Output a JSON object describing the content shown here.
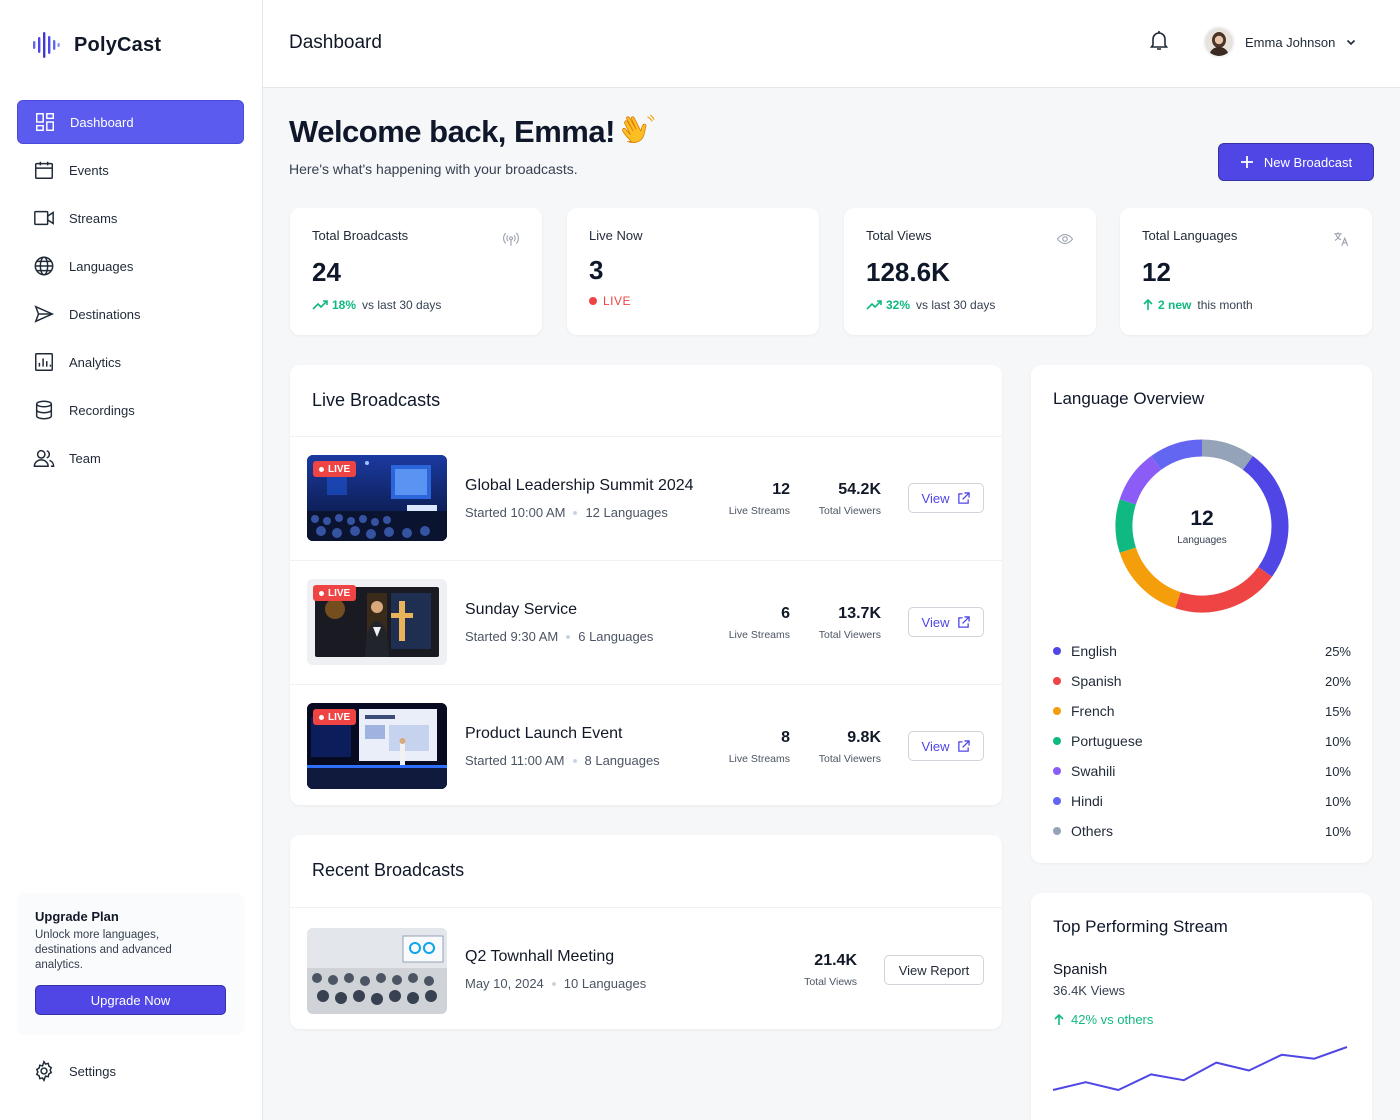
{
  "brand": {
    "name": "PolyCast"
  },
  "sidebar": {
    "items": [
      {
        "label": "Dashboard",
        "icon": "dashboard-icon",
        "active": true
      },
      {
        "label": "Events",
        "icon": "calendar-icon"
      },
      {
        "label": "Streams",
        "icon": "video-icon"
      },
      {
        "label": "Languages",
        "icon": "globe-icon"
      },
      {
        "label": "Destinations",
        "icon": "send-icon"
      },
      {
        "label": "Analytics",
        "icon": "analytics-icon"
      },
      {
        "label": "Recordings",
        "icon": "database-icon"
      },
      {
        "label": "Team",
        "icon": "team-icon"
      }
    ],
    "upgrade": {
      "title": "Upgrade Plan",
      "desc": "Unlock more languages, destinations and advanced analytics.",
      "button": "Upgrade Now"
    },
    "settings": "Settings"
  },
  "header": {
    "title": "Dashboard",
    "user_name": "Emma Johnson"
  },
  "welcome": {
    "title": "Welcome back, Emma!",
    "subtitle": "Here's what's happening with your broadcasts.",
    "new_button": "New Broadcast"
  },
  "stats": [
    {
      "label": "Total Broadcasts",
      "value": "24",
      "delta": "18%",
      "note": "vs last 30 days"
    },
    {
      "label": "Live Now",
      "value": "3",
      "badge": "LIVE"
    },
    {
      "label": "Total Views",
      "value": "128.6K",
      "delta": "32%",
      "note": "vs last 30 days"
    },
    {
      "label": "Total Languages",
      "value": "12",
      "delta": "2 new",
      "note": "this month"
    }
  ],
  "live": {
    "title": "Live Broadcasts",
    "badge": "LIVE",
    "view_label": "View",
    "streams_label": "Live Streams",
    "viewers_label": "Total Viewers",
    "items": [
      {
        "name": "Global Leadership Summit 2024",
        "started": "Started 10:00 AM",
        "languages": "12 Languages",
        "streams": "12",
        "viewers": "54.2K"
      },
      {
        "name": "Sunday Service",
        "started": "Started 9:30 AM",
        "languages": "6 Languages",
        "streams": "6",
        "viewers": "13.7K"
      },
      {
        "name": "Product Launch Event",
        "started": "Started 11:00 AM",
        "languages": "8 Languages",
        "streams": "8",
        "viewers": "9.8K"
      }
    ]
  },
  "recent": {
    "title": "Recent Broadcasts",
    "items": [
      {
        "name": "Q2 Townhall Meeting",
        "date": "May 10, 2024",
        "languages": "10 Languages",
        "views": "21.4K",
        "views_label": "Total Views",
        "button": "View Report"
      }
    ]
  },
  "language_overview": {
    "title": "Language Overview",
    "center_value": "12",
    "center_label": "Languages",
    "items": [
      {
        "name": "English",
        "pct": "25%",
        "value": 25,
        "color": "#4f46e5"
      },
      {
        "name": "Spanish",
        "pct": "20%",
        "value": 20,
        "color": "#ef4444"
      },
      {
        "name": "French",
        "pct": "15%",
        "value": 15,
        "color": "#f59e0b"
      },
      {
        "name": "Portuguese",
        "pct": "10%",
        "value": 10,
        "color": "#10b981"
      },
      {
        "name": "Swahili",
        "pct": "10%",
        "value": 10,
        "color": "#8b5cf6"
      },
      {
        "name": "Hindi",
        "pct": "10%",
        "value": 10,
        "color": "#6366f1"
      },
      {
        "name": "Others",
        "pct": "10%",
        "value": 10,
        "color": "#94a3b8"
      }
    ]
  },
  "top_stream": {
    "title": "Top Performing Stream",
    "name": "Spanish",
    "views": "36.4K Views",
    "delta": "42% vs others",
    "sparkline": [
      30,
      34,
      30,
      38,
      35,
      44,
      40,
      48,
      46,
      52
    ]
  },
  "colors": {
    "accent": "#4f46e5",
    "live": "#ef4444",
    "positive": "#10b981"
  }
}
